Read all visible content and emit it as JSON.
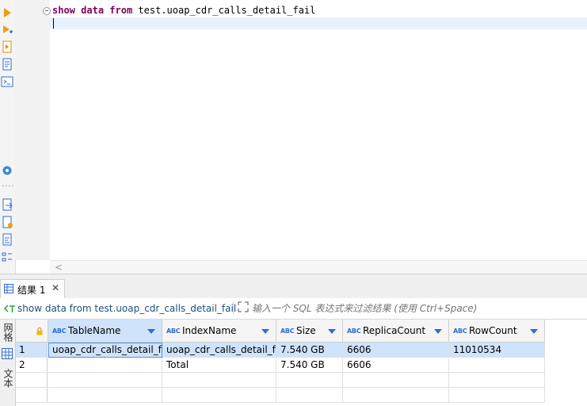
{
  "editor": {
    "sql_keywords": [
      "show",
      "data",
      "from"
    ],
    "sql_table": "test.uoap_cdr_calls_detail_fail"
  },
  "results_tab": {
    "label": "结果 1"
  },
  "filter": {
    "query_text": "show data from test.uoap_cdr_calls_detail_fail",
    "placeholder": "输入一个 SQL 表达式来过滤结果 (使用 Ctrl+Space)"
  },
  "side_tabs": {
    "grid": "网格",
    "text": "文本"
  },
  "grid": {
    "columns": [
      "TableName",
      "IndexName",
      "Size",
      "ReplicaCount",
      "RowCount"
    ],
    "rows": [
      {
        "num": "1",
        "cells": [
          "uoap_cdr_calls_detail_fail",
          "uoap_cdr_calls_detail_fail",
          "7.540 GB",
          "6606",
          "11010534"
        ]
      },
      {
        "num": "2",
        "cells": [
          "",
          "Total",
          "7.540 GB",
          "6606",
          ""
        ]
      }
    ]
  },
  "colors": {
    "accent": "#2f6bd0",
    "selection": "#cfe3fb",
    "keyword": "#7f0055",
    "current_line": "#e8f2fe"
  }
}
